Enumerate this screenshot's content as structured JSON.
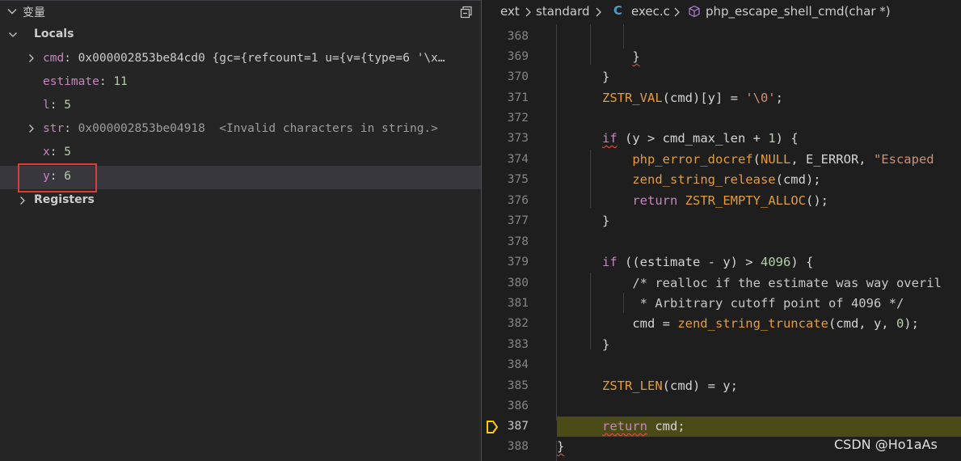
{
  "variables_panel": {
    "title": "变量",
    "groups": {
      "locals": {
        "label": "Locals"
      },
      "registers": {
        "label": "Registers"
      }
    },
    "vars": [
      {
        "name": "cmd",
        "sep": ": ",
        "value": "0x000002853be84cd0 {gc={refcount=1 u={v={type=6 '\\x…",
        "kind": "ptr",
        "expandable": true
      },
      {
        "name": "estimate",
        "sep": ": ",
        "value": "11",
        "kind": "num",
        "expandable": false
      },
      {
        "name": "l",
        "sep": ": ",
        "value": "5",
        "kind": "num",
        "expandable": false
      },
      {
        "name": "str",
        "sep": ": ",
        "value": "0x000002853be04918  <Invalid characters in string.>",
        "kind": "ptr",
        "expandable": true
      },
      {
        "name": "x",
        "sep": ": ",
        "value": "5",
        "kind": "num",
        "expandable": false
      },
      {
        "name": "y",
        "sep": ": ",
        "value": "6",
        "kind": "num",
        "expandable": false
      }
    ],
    "highlight_color": "#e53935"
  },
  "breadcrumb": {
    "items": [
      "ext",
      "standard",
      "exec.c",
      "php_escape_shell_cmd(char *)"
    ],
    "file_icon_letter": "C"
  },
  "editor": {
    "line_numbers": [
      "368",
      "369",
      "370",
      "371",
      "372",
      "373",
      "374",
      "375",
      "376",
      "377",
      "378",
      "379",
      "380",
      "381",
      "382",
      "383",
      "384",
      "385",
      "386",
      "387",
      "388"
    ],
    "current_line": "387",
    "current_line_color": "#4b4b18"
  },
  "watermark": "CSDN @Ho1aAs"
}
